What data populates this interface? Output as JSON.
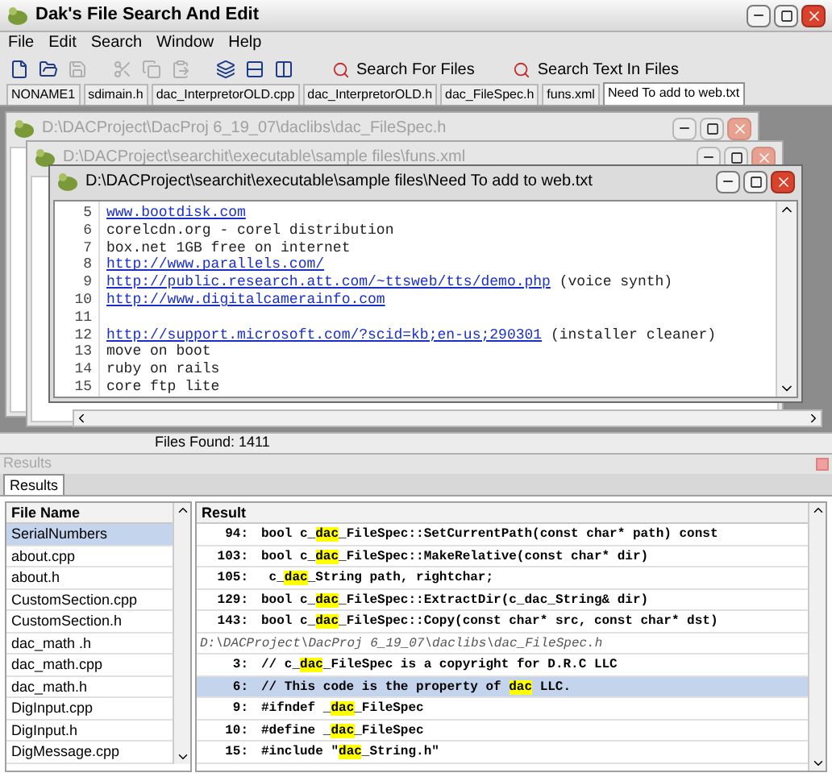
{
  "window": {
    "title": "Dak's File Search And Edit"
  },
  "menu": [
    "File",
    "Edit",
    "Search",
    "Window",
    "Help"
  ],
  "toolbar": {
    "icons": [
      {
        "kind": "new",
        "disabled": false
      },
      {
        "kind": "open",
        "disabled": false
      },
      {
        "kind": "save",
        "disabled": true
      },
      {
        "kind": "cut",
        "disabled": true
      },
      {
        "kind": "copy",
        "disabled": true
      },
      {
        "kind": "paste",
        "disabled": true
      },
      {
        "kind": "cascade",
        "disabled": false
      },
      {
        "kind": "tile-horizontal",
        "disabled": false
      },
      {
        "kind": "tile-vertical",
        "disabled": false
      }
    ],
    "buttons": [
      "Search For Files",
      "Search Text In Files"
    ]
  },
  "tabs": [
    {
      "label": "NONAME1",
      "selected": false
    },
    {
      "label": "sdimain.h",
      "selected": false
    },
    {
      "label": "dac_InterpretorOLD.cpp",
      "selected": false
    },
    {
      "label": "dac_InterpretorOLD.h",
      "selected": false
    },
    {
      "label": "dac_FileSpec.h",
      "selected": false
    },
    {
      "label": "funs.xml",
      "selected": false
    },
    {
      "label": "Need To add to web.txt",
      "selected": true
    }
  ],
  "documents": [
    {
      "title": "D:\\DACProject\\DacProj 6_19_07\\daclibs\\dac_FileSpec.h",
      "active": false
    },
    {
      "title": "D:\\DACProject\\searchit\\executable\\sample files\\funs.xml",
      "active": false
    },
    {
      "title": "D:\\DACProject\\searchit\\executable\\sample files\\Need To add to web.txt",
      "active": true,
      "lines": [
        {
          "number": "5",
          "link": "www.bootdisk.com"
        },
        {
          "number": "6",
          "text": "corelcdn.org - corel distribution"
        },
        {
          "number": "7",
          "text": "box.net 1GB free on internet"
        },
        {
          "number": "8",
          "link": "http://www.parallels.com/"
        },
        {
          "number": "9",
          "link": "http://public.research.att.com/~ttsweb/tts/demo.php",
          "text": " (voice synth)"
        },
        {
          "number": "10",
          "link": "http://www.digitalcamerainfo.com"
        },
        {
          "number": "11"
        },
        {
          "number": "12",
          "link": "http://support.microsoft.com/?scid=kb;en-us;290301",
          "text": " (installer cleaner)"
        },
        {
          "number": "13",
          "text": "move on boot"
        },
        {
          "number": "14",
          "text": "ruby on rails"
        },
        {
          "number": "15",
          "text": "core ftp lite"
        }
      ]
    }
  ],
  "status_bar": {
    "text": "Files Found: 1411"
  },
  "results_panel": {
    "title": "Results",
    "tabs": [
      {
        "label": "Results",
        "selected": true
      }
    ],
    "file_list": {
      "heading": "File Name",
      "items": [
        {
          "name": "SerialNumbers",
          "selected": true
        },
        {
          "name": "about.cpp",
          "selected": false
        },
        {
          "name": "about.h",
          "selected": false
        },
        {
          "name": "CustomSection.cpp",
          "selected": false
        },
        {
          "name": "CustomSection.h",
          "selected": false
        },
        {
          "name": "dac_math .h",
          "selected": false
        },
        {
          "name": "dac_math.cpp",
          "selected": false
        },
        {
          "name": "dac_math.h",
          "selected": false
        },
        {
          "name": "DigInput.cpp",
          "selected": false
        },
        {
          "name": "DigInput.h",
          "selected": false
        },
        {
          "name": "DigMessage.cpp",
          "selected": false
        }
      ]
    },
    "results": {
      "heading": "Result",
      "rows": [
        {
          "kind": "match",
          "line": "94:",
          "selected": false,
          "segments": [
            {
              "text": "bool c_",
              "hit": false
            },
            {
              "text": "dac",
              "hit": true
            },
            {
              "text": "_FileSpec::SetCurrentPath(const char* path) const",
              "hit": false
            }
          ]
        },
        {
          "kind": "match",
          "line": "103:",
          "selected": false,
          "segments": [
            {
              "text": "bool c_",
              "hit": false
            },
            {
              "text": "dac",
              "hit": true
            },
            {
              "text": "_FileSpec::MakeRelative(const char* dir)",
              "hit": false
            }
          ]
        },
        {
          "kind": "match",
          "line": "105:",
          "selected": false,
          "segments": [
            {
              "text": " c_",
              "hit": false
            },
            {
              "text": "dac",
              "hit": true
            },
            {
              "text": "_String path, rightchar;",
              "hit": false
            }
          ]
        },
        {
          "kind": "match",
          "line": "129:",
          "selected": false,
          "segments": [
            {
              "text": "bool c_",
              "hit": false
            },
            {
              "text": "dac",
              "hit": true
            },
            {
              "text": "_FileSpec::ExtractDir(c_dac_String& dir)",
              "hit": false
            }
          ]
        },
        {
          "kind": "match",
          "line": "143:",
          "selected": false,
          "segments": [
            {
              "text": "bool c_",
              "hit": false
            },
            {
              "text": "dac",
              "hit": true
            },
            {
              "text": "_FileSpec::Copy(const char* src, const char* dst)",
              "hit": false
            }
          ]
        },
        {
          "kind": "path",
          "text": "D:\\DACProject\\DacProj 6_19_07\\daclibs\\dac_FileSpec.h",
          "selected": false
        },
        {
          "kind": "match",
          "line": "3:",
          "selected": false,
          "segments": [
            {
              "text": "// c_",
              "hit": false
            },
            {
              "text": "dac",
              "hit": true
            },
            {
              "text": "_FileSpec is a copyright for D.R.C LLC",
              "hit": false
            }
          ]
        },
        {
          "kind": "match",
          "line": "6:",
          "selected": true,
          "segments": [
            {
              "text": "// This code is the property of ",
              "hit": false
            },
            {
              "text": "dac",
              "hit": true
            },
            {
              "text": " LLC.",
              "hit": false
            }
          ]
        },
        {
          "kind": "match",
          "line": "9:",
          "selected": false,
          "segments": [
            {
              "text": "#ifndef _",
              "hit": false
            },
            {
              "text": "dac",
              "hit": true
            },
            {
              "text": "_FileSpec",
              "hit": false
            }
          ]
        },
        {
          "kind": "match",
          "line": "10:",
          "selected": false,
          "segments": [
            {
              "text": "#define _",
              "hit": false
            },
            {
              "text": "dac",
              "hit": true
            },
            {
              "text": "_FileSpec",
              "hit": false
            }
          ]
        },
        {
          "kind": "match",
          "line": "15:",
          "selected": false,
          "segments": [
            {
              "text": "#include \"",
              "hit": false
            },
            {
              "text": "dac",
              "hit": true
            },
            {
              "text": "_String.h\"",
              "hit": false
            }
          ]
        }
      ]
    }
  }
}
